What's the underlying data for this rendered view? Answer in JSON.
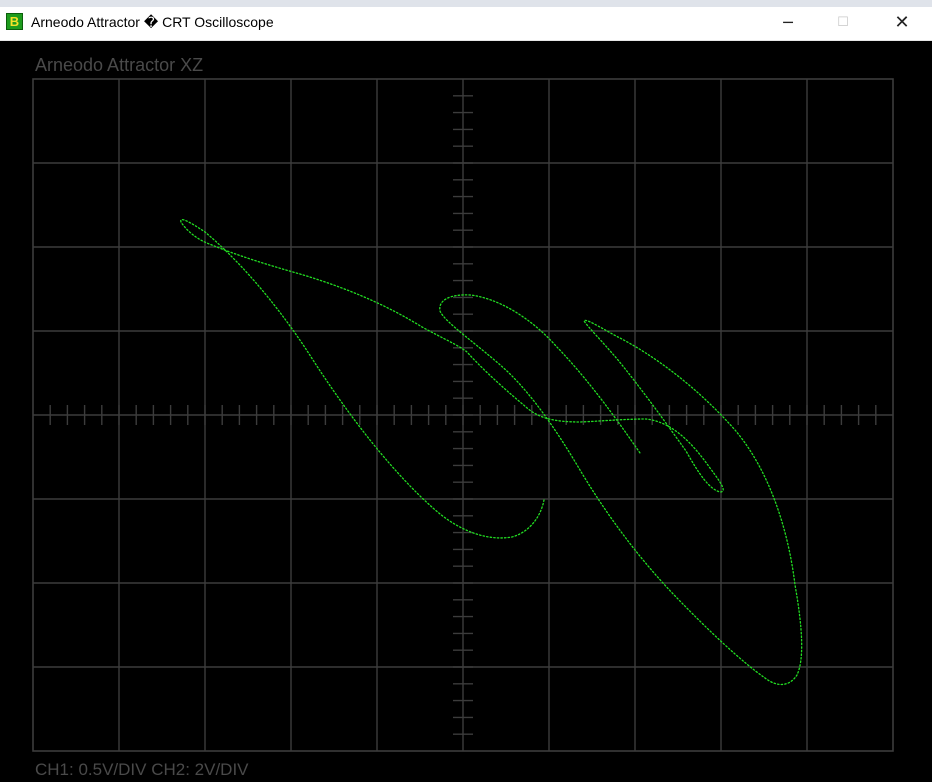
{
  "window": {
    "title": "Arneodo Attractor � CRT Oscilloscope",
    "icon_letter": "B",
    "icon_colors": {
      "background": "#1e9c1e",
      "letter": "#f5e12a"
    },
    "controls": {
      "minimize": "─",
      "maximize": "☐",
      "close": "✕"
    }
  },
  "scope": {
    "title": "Arneodo Attractor  XZ",
    "channel_info": "CH1: 0.5V/DIV   CH2: 2V/DIV",
    "divisions": {
      "x": 10,
      "y": 8
    },
    "ch1_volts_per_div": 0.5,
    "ch2_volts_per_div": 2,
    "colors": {
      "background": "#000000",
      "grid": "#3c3c3c",
      "trace": "#22dd22",
      "label": "#4a4a4a"
    }
  }
}
